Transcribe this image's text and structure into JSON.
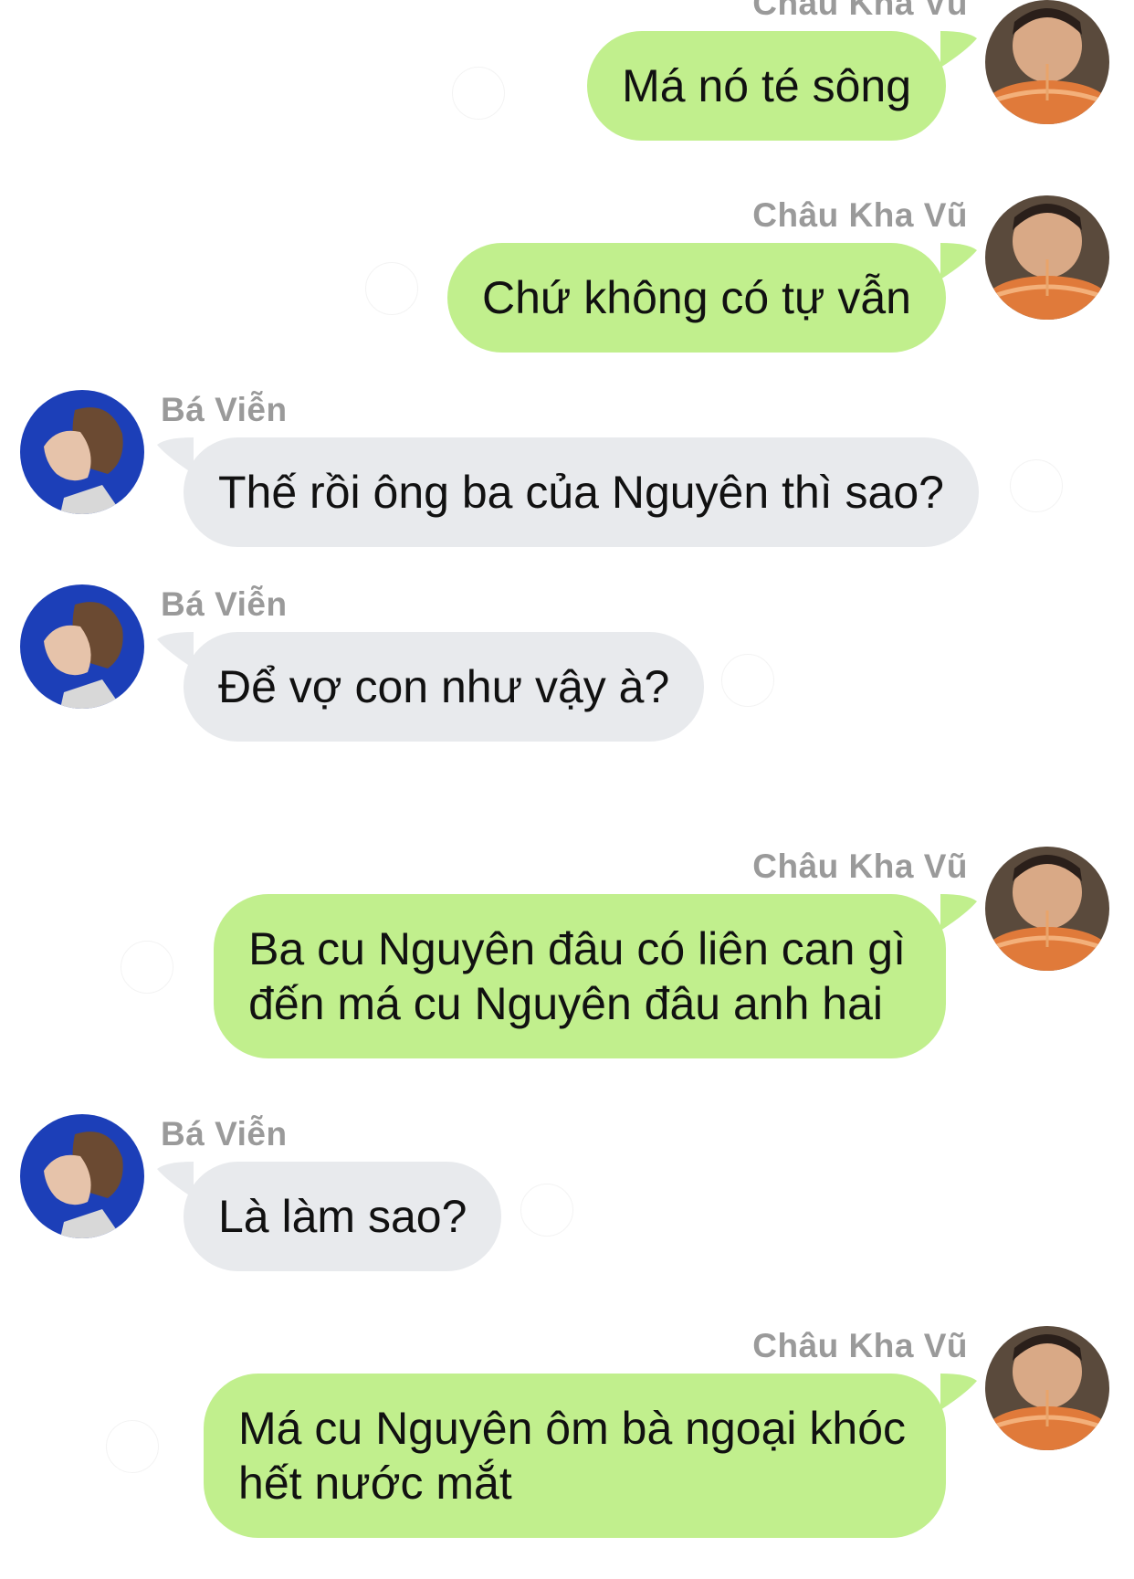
{
  "conversation": {
    "messages": [
      {
        "sender": "Châu Kha Vũ",
        "side": "right",
        "lines": [
          "Má nó té sông"
        ]
      },
      {
        "sender": "Châu Kha Vũ",
        "side": "right",
        "lines": [
          "Chứ không có tự vẫn"
        ]
      },
      {
        "sender": "Bá Viễn",
        "side": "left",
        "lines": [
          "Thế rồi ông ba của Nguyên thì sao?"
        ]
      },
      {
        "sender": "Bá Viễn",
        "side": "left",
        "lines": [
          "Để vợ con như vậy à?"
        ]
      },
      {
        "sender": "Châu Kha Vũ",
        "side": "right",
        "lines": [
          "Ba cu Nguyên đâu có liên can gì",
          "đến má cu Nguyên đâu anh hai"
        ]
      },
      {
        "sender": "Bá Viễn",
        "side": "left",
        "lines": [
          "Là làm sao?"
        ]
      },
      {
        "sender": "Châu Kha Vũ",
        "side": "right",
        "lines": [
          "Má cu Nguyên ôm bà ngoại khóc",
          "hết nước mắt"
        ]
      }
    ]
  },
  "colors": {
    "outgoing_bubble": "#c1ef8d",
    "incoming_bubble": "#e8eaed",
    "sender_name": "#9a9a9a",
    "incoming_avatar_bg": "#1c3fb8"
  },
  "icons": {
    "outgoing_avatar": "avatar-child-eating-noodles",
    "incoming_avatar": "avatar-profile-portrait",
    "reaction": "add-reaction-icon"
  }
}
